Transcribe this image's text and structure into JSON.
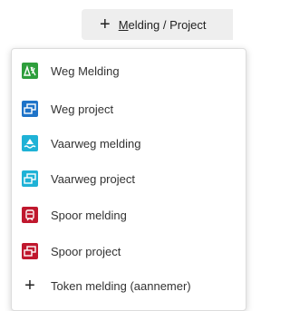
{
  "trigger": {
    "label_access": "M",
    "label_rest": "elding / Project"
  },
  "menu": {
    "items": [
      {
        "label": "Weg Melding",
        "icon": "road-warning-icon",
        "color": "#2e9e3c"
      },
      {
        "label": "Weg project",
        "icon": "road-project-icon",
        "color": "#1e73c8"
      },
      {
        "label": "Vaarweg melding",
        "icon": "waterway-warning-icon",
        "color": "#1fb2d6"
      },
      {
        "label": "Vaarweg project",
        "icon": "waterway-project-icon",
        "color": "#1fb2d6"
      },
      {
        "label": "Spoor melding",
        "icon": "rail-warning-icon",
        "color": "#c0182e"
      },
      {
        "label": "Spoor project",
        "icon": "rail-project-icon",
        "color": "#c0182e"
      },
      {
        "label": "Token melding (aannemer)",
        "icon": "plus-icon",
        "color": "#222222"
      }
    ]
  }
}
